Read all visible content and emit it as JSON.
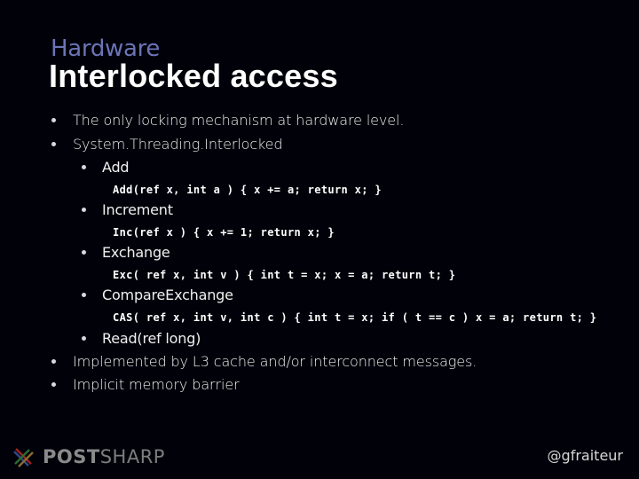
{
  "slide": {
    "subtitle": "Hardware",
    "title": "Interlocked access"
  },
  "bullets": [
    {
      "level": 1,
      "text": "The only locking mechanism at hardware level."
    },
    {
      "level": 1,
      "text": "System.Threading.Interlocked"
    },
    {
      "level": 2,
      "text": "Add"
    },
    {
      "level": "code",
      "text": "Add(ref x, int a ) { x += a; return x; }"
    },
    {
      "level": 2,
      "text": "Increment"
    },
    {
      "level": "code",
      "text": "Inc(ref x ) { x += 1; return x; }"
    },
    {
      "level": 2,
      "text": "Exchange"
    },
    {
      "level": "code",
      "text": "Exc( ref x, int v ) { int t = x; x = a; return t; }"
    },
    {
      "level": 2,
      "text": "CompareExchange"
    },
    {
      "level": "code",
      "text": "CAS( ref x, int v, int c ) { int t = x; if ( t == c ) x = a; return t; }"
    },
    {
      "level": 2,
      "text": "Read(ref long)"
    },
    {
      "level": 1,
      "text": "Implemented by L3 cache and/or interconnect messages."
    },
    {
      "level": 1,
      "text": "Implicit memory barrier"
    }
  ],
  "footer": {
    "logo_icon": "postsharp-cross-icon",
    "logo_bold": "POST",
    "logo_light": "SHARP",
    "handle": "@gfraiteur"
  }
}
